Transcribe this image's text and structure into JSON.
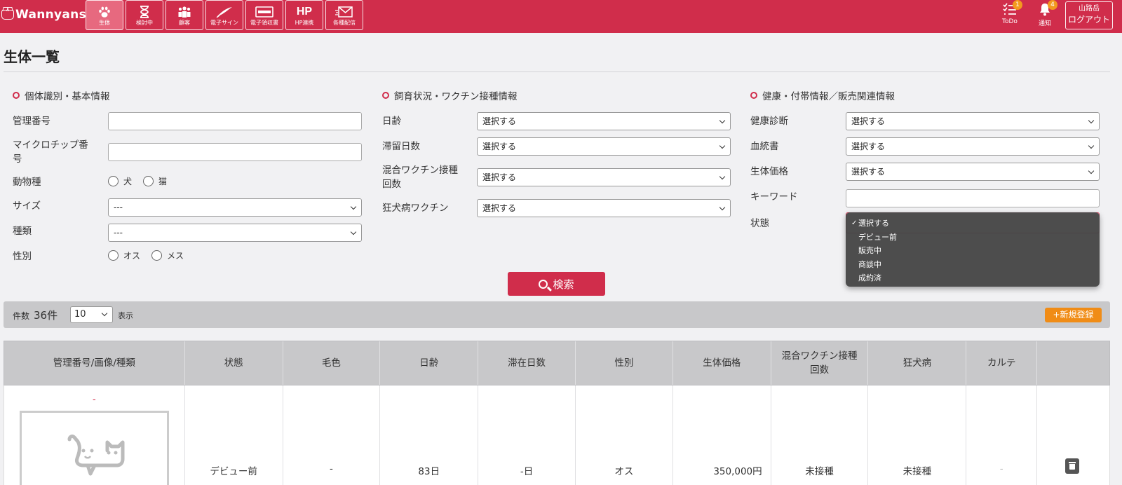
{
  "app": {
    "logo": "Wannyans",
    "nav": [
      {
        "label": "生体",
        "icon": "paw-icon"
      },
      {
        "label": "検討中",
        "icon": "hourglass-icon"
      },
      {
        "label": "顧客",
        "icon": "people-icon"
      },
      {
        "label": "電子サイン",
        "icon": "quill-icon"
      },
      {
        "label": "電子領収書",
        "icon": "receipt-icon"
      },
      {
        "label": "HP連携",
        "icon": "hp-icon",
        "icon_text": "HP"
      },
      {
        "label": "各種配信",
        "icon": "mail-icon"
      }
    ],
    "todo": {
      "label": "ToDo",
      "badge": "1"
    },
    "notice": {
      "label": "通知",
      "badge": "4"
    },
    "user": {
      "name": "山路岳",
      "logout": "ログアウト"
    }
  },
  "page": {
    "title": "生体一覧"
  },
  "search": {
    "sections": [
      {
        "title": "個体識別・基本情報"
      },
      {
        "title": "飼育状況・ワクチン接種情報"
      },
      {
        "title": "健康・付帯情報／販売関連情報"
      }
    ],
    "col1": {
      "mgmt_no": "管理番号",
      "microchip_line1": "マイクロチップ番",
      "microchip_line2": "号",
      "species": "動物種",
      "species_options": [
        "犬",
        "猫"
      ],
      "size": "サイズ",
      "size_value": "---",
      "breed": "種類",
      "breed_value": "---",
      "sex": "性別",
      "sex_options": [
        "オス",
        "メス"
      ]
    },
    "col2": {
      "age": "日齢",
      "stay": "滞留日数",
      "mixed_line1": "混合ワクチン接種",
      "mixed_line2": "回数",
      "rabies": "狂犬病ワクチン",
      "placeholder": "選択する"
    },
    "col3": {
      "health": "健康診断",
      "pedigree": "血統書",
      "price": "生体価格",
      "keyword": "キーワード",
      "status": "状態",
      "placeholder": "選択する"
    },
    "status_dropdown": {
      "options": [
        "選択する",
        "デビュー前",
        "販売中",
        "商談中",
        "成約済"
      ],
      "selected": "選択する"
    },
    "search_button": "検索"
  },
  "results": {
    "count_label": "件数",
    "count": "36件",
    "per_page": "10",
    "show_label": "表示",
    "new_button": "+新規登録"
  },
  "table": {
    "headers": [
      "管理番号/画像/種類",
      "状態",
      "毛色",
      "日齢",
      "滞在日数",
      "性別",
      "生体価格",
      "混合ワクチン接種回数",
      "狂犬病",
      "カルテ",
      ""
    ],
    "rows": [
      {
        "mgmt": "-",
        "status": "デビュー前",
        "color": "-",
        "age": "83日",
        "stay": "-日",
        "sex": "オス",
        "price": "350,000円",
        "mixed": "未接種",
        "rabies": "未接種",
        "karte": "-"
      }
    ]
  }
}
